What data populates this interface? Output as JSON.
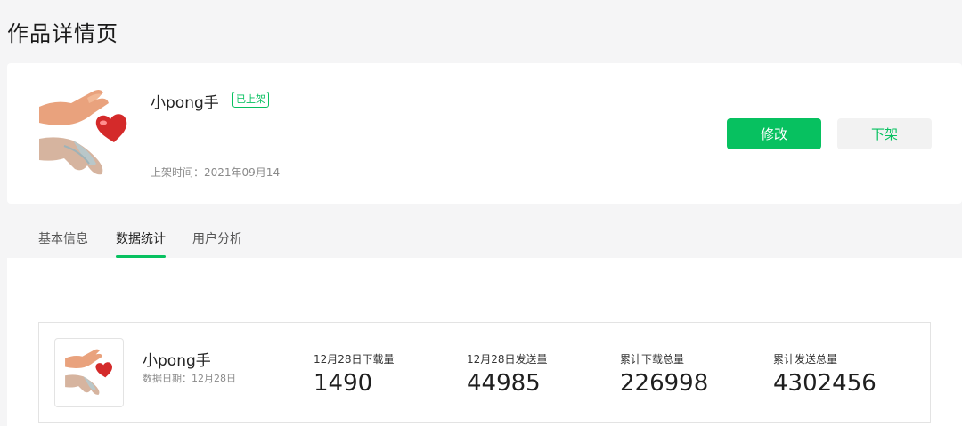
{
  "page": {
    "title": "作品详情页"
  },
  "work": {
    "name": "小pong手",
    "status_badge": "已上架",
    "publish_time": "上架时间：2021年09月14",
    "cover_icon": "hands-heart-sticker-icon"
  },
  "actions": {
    "edit_label": "修改",
    "unpublish_label": "下架"
  },
  "tabs": [
    {
      "label": "基本信息",
      "active": false
    },
    {
      "label": "数据统计",
      "active": true
    },
    {
      "label": "用户分析",
      "active": false
    }
  ],
  "stats": {
    "name": "小pong手",
    "date": "数据日期：12月28日",
    "metrics": [
      {
        "label": "12月28日下载量",
        "value": "1490"
      },
      {
        "label": "12月28日发送量",
        "value": "44985"
      },
      {
        "label": "累计下载总量",
        "value": "226998"
      },
      {
        "label": "累计发送总量",
        "value": "4302456"
      }
    ]
  },
  "colors": {
    "accent": "#07c160",
    "background": "#f5f5f6"
  }
}
